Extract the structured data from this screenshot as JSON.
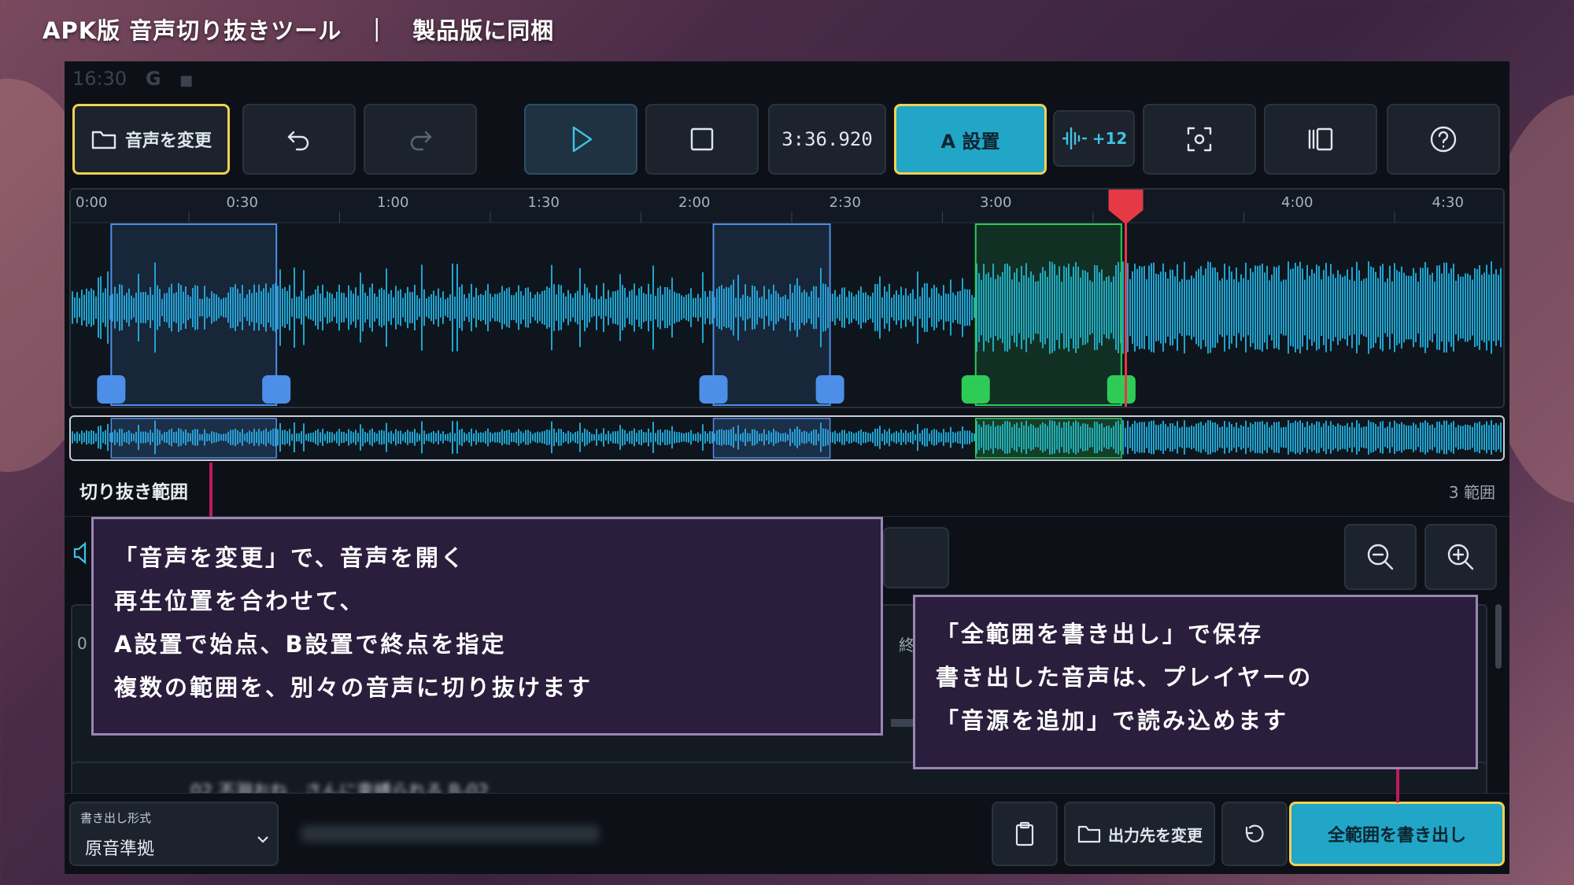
{
  "banner": {
    "title": "APK版 音声切り抜きツール　｜　製品版に同梱"
  },
  "statusbar": {
    "time": "16:30",
    "icon1": "G",
    "icon2": "■"
  },
  "toolbar": {
    "open_label": "音声を変更",
    "time_display": "3:36.920",
    "set_a_label": "A 設置",
    "gain_label": "+12",
    "icons": [
      "folder-icon",
      "undo-icon",
      "redo-icon",
      "play-icon",
      "stop-icon",
      "waveform-icon",
      "screenshot-icon",
      "layout-icon",
      "help-icon"
    ]
  },
  "timeline": {
    "ticks": [
      "0:00",
      "0:30",
      "1:00",
      "1:30",
      "2:00",
      "2:30",
      "3:00",
      "3",
      "4:00",
      "4:30"
    ],
    "colors": {
      "wave": "#1fa4d1",
      "blue_region": "#4d8fe8",
      "green_region": "#2ecc57",
      "playhead": "#e63946"
    },
    "playhead_time": "3:36.920",
    "regions": [
      {
        "start": "0:08",
        "end": "0:42",
        "color": "blue"
      },
      {
        "start": "2:12",
        "end": "2:36",
        "color": "blue"
      },
      {
        "start": "3:06",
        "end": "3:36",
        "color": "green"
      }
    ]
  },
  "ranges": {
    "title": "切り抜き範囲",
    "count": "3 範囲",
    "row_prefix": "0",
    "row_label_partial": "終"
  },
  "row2": {
    "blurred": "02  不淵おね…さんに束縛られる  B-02"
  },
  "bottom": {
    "format_label": "書き出し形式",
    "format_value": "原音準拠",
    "output_label": "出力先を変更",
    "export_label": "全範囲を書き出し"
  },
  "callout_left": {
    "lines": [
      "「音声を変更」で、音声を開く",
      "再生位置を合わせて、",
      "A設置で始点、B設置で終点を指定",
      "複数の範囲を、別々の音声に切り抜けます"
    ]
  },
  "callout_right": {
    "lines": [
      "「全範囲を書き出し」で保存",
      "書き出した音声は、プレイヤーの",
      "「音源を追加」で読み込めます"
    ]
  }
}
